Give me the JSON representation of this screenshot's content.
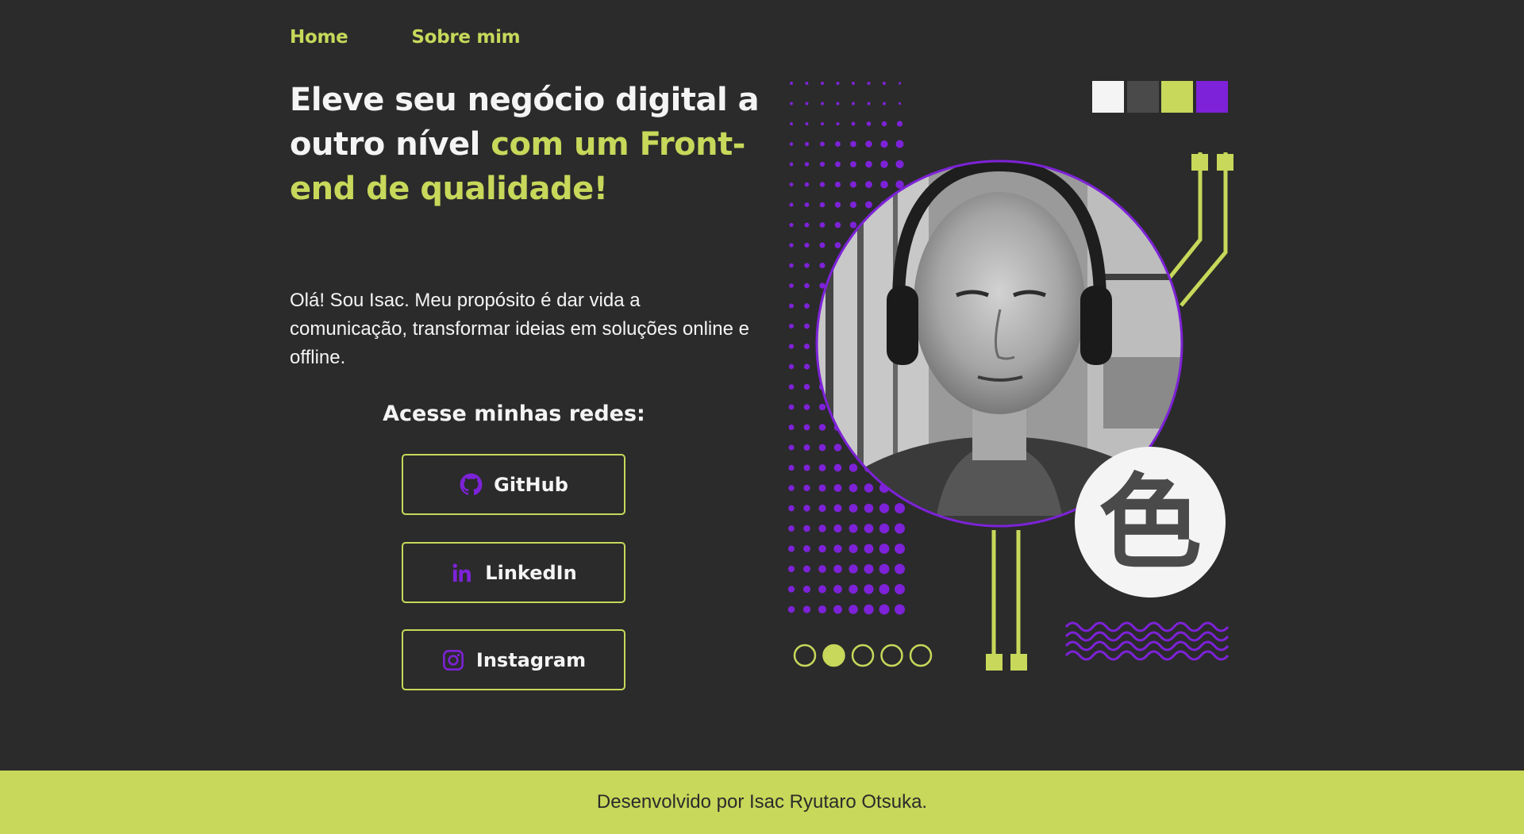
{
  "nav": {
    "home": "Home",
    "about": "Sobre mim"
  },
  "hero": {
    "title_plain": "Eleve seu negócio digital a outro nível ",
    "title_accent": "com um Front-end de qualidade!",
    "intro": "Olá! Sou Isac. Meu propósito é dar vida a comunicação, transformar ideias em soluções online e offline."
  },
  "social": {
    "heading": "Acesse minhas redes:",
    "github": "GitHub",
    "linkedin": "LinkedIn",
    "instagram": "Instagram"
  },
  "decor": {
    "palette": [
      "#f4f4f4",
      "#4a4a4a",
      "#c7d85a",
      "#7d22d8"
    ],
    "carousel": {
      "count": 5,
      "active": 2
    },
    "kanji": "色"
  },
  "footer": {
    "credit": "Desenvolvido por Isac Ryutaro Otsuka."
  },
  "colors": {
    "background": "#2b2b2b",
    "accent": "#c7d85a",
    "purple": "#7d22d8",
    "text": "#f4f4f4"
  }
}
